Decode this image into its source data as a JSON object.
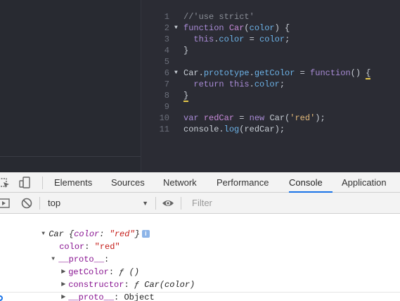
{
  "editor": {
    "lines": [
      {
        "n": "1",
        "fold": false,
        "tokens": [
          {
            "t": "//'use strict'",
            "c": "t-comment"
          }
        ]
      },
      {
        "n": "2",
        "fold": true,
        "tokens": [
          {
            "t": "function ",
            "c": "t-kw"
          },
          {
            "t": "Car",
            "c": "t-fn"
          },
          {
            "t": "(",
            "c": "t-var"
          },
          {
            "t": "color",
            "c": "t-prop"
          },
          {
            "t": ") {",
            "c": "t-var"
          }
        ]
      },
      {
        "n": "3",
        "fold": false,
        "tokens": [
          {
            "t": "  this",
            "c": "t-kw"
          },
          {
            "t": ".",
            "c": "t-var"
          },
          {
            "t": "color",
            "c": "t-prop"
          },
          {
            "t": " = ",
            "c": "t-var"
          },
          {
            "t": "color",
            "c": "t-prop"
          },
          {
            "t": ";",
            "c": "t-var"
          }
        ]
      },
      {
        "n": "4",
        "fold": false,
        "tokens": [
          {
            "t": "}",
            "c": "t-var"
          }
        ]
      },
      {
        "n": "5",
        "fold": false,
        "tokens": []
      },
      {
        "n": "6",
        "fold": true,
        "tokens": [
          {
            "t": "Car",
            "c": "t-var"
          },
          {
            "t": ".",
            "c": "t-var"
          },
          {
            "t": "prototype",
            "c": "t-prop"
          },
          {
            "t": ".",
            "c": "t-var"
          },
          {
            "t": "getColor",
            "c": "t-prop"
          },
          {
            "t": " = ",
            "c": "t-var"
          },
          {
            "t": "function",
            "c": "t-kw"
          },
          {
            "t": "() ",
            "c": "t-var"
          },
          {
            "t": "{",
            "c": "t-var t-brace-hl"
          }
        ]
      },
      {
        "n": "7",
        "fold": false,
        "tokens": [
          {
            "t": "  return ",
            "c": "t-kw"
          },
          {
            "t": "this",
            "c": "t-kw"
          },
          {
            "t": ".",
            "c": "t-var"
          },
          {
            "t": "color",
            "c": "t-prop"
          },
          {
            "t": ";",
            "c": "t-var"
          }
        ]
      },
      {
        "n": "8",
        "fold": false,
        "tokens": [
          {
            "t": "}",
            "c": "t-var t-brace-hl"
          }
        ]
      },
      {
        "n": "9",
        "fold": false,
        "tokens": []
      },
      {
        "n": "10",
        "fold": false,
        "tokens": [
          {
            "t": "var ",
            "c": "t-kw"
          },
          {
            "t": "redCar",
            "c": "t-fn"
          },
          {
            "t": " = ",
            "c": "t-var"
          },
          {
            "t": "new ",
            "c": "t-kw"
          },
          {
            "t": "Car",
            "c": "t-var"
          },
          {
            "t": "(",
            "c": "t-var"
          },
          {
            "t": "'red'",
            "c": "t-str"
          },
          {
            "t": ");",
            "c": "t-var"
          }
        ]
      },
      {
        "n": "11",
        "fold": false,
        "tokens": [
          {
            "t": "console",
            "c": "t-var"
          },
          {
            "t": ".",
            "c": "t-var"
          },
          {
            "t": "log",
            "c": "t-prop"
          },
          {
            "t": "(",
            "c": "t-var"
          },
          {
            "t": "redCar",
            "c": "t-var"
          },
          {
            "t": ");",
            "c": "t-var"
          }
        ]
      }
    ]
  },
  "devtools": {
    "tabs": [
      "Elements",
      "Sources",
      "Network",
      "Performance",
      "Console",
      "Application"
    ],
    "active_tab": "Console",
    "icons": [
      "inspect-icon",
      "device-toggle-icon",
      "sidebar-toggle-icon",
      "clear-console-icon",
      "eye-icon"
    ],
    "context": "top",
    "filter_placeholder": "Filter"
  },
  "console": {
    "object_name": "Car",
    "object_preview_key": "color",
    "object_preview_value": "\"red\"",
    "prop_color_key": "color",
    "prop_color_value": "\"red\"",
    "proto_label": "__proto__",
    "getColor_key": "getColor",
    "getColor_value": "ƒ ()",
    "constructor_key": "constructor",
    "constructor_value": "ƒ Car(color)",
    "inner_proto_key": "__proto__",
    "inner_proto_value": "Object",
    "info_badge": "i"
  },
  "colors": {
    "editor_bg": "#2b2c34",
    "active_tab_accent": "#1a73e8",
    "key_purple": "#881391",
    "string_red": "#c41a16"
  }
}
